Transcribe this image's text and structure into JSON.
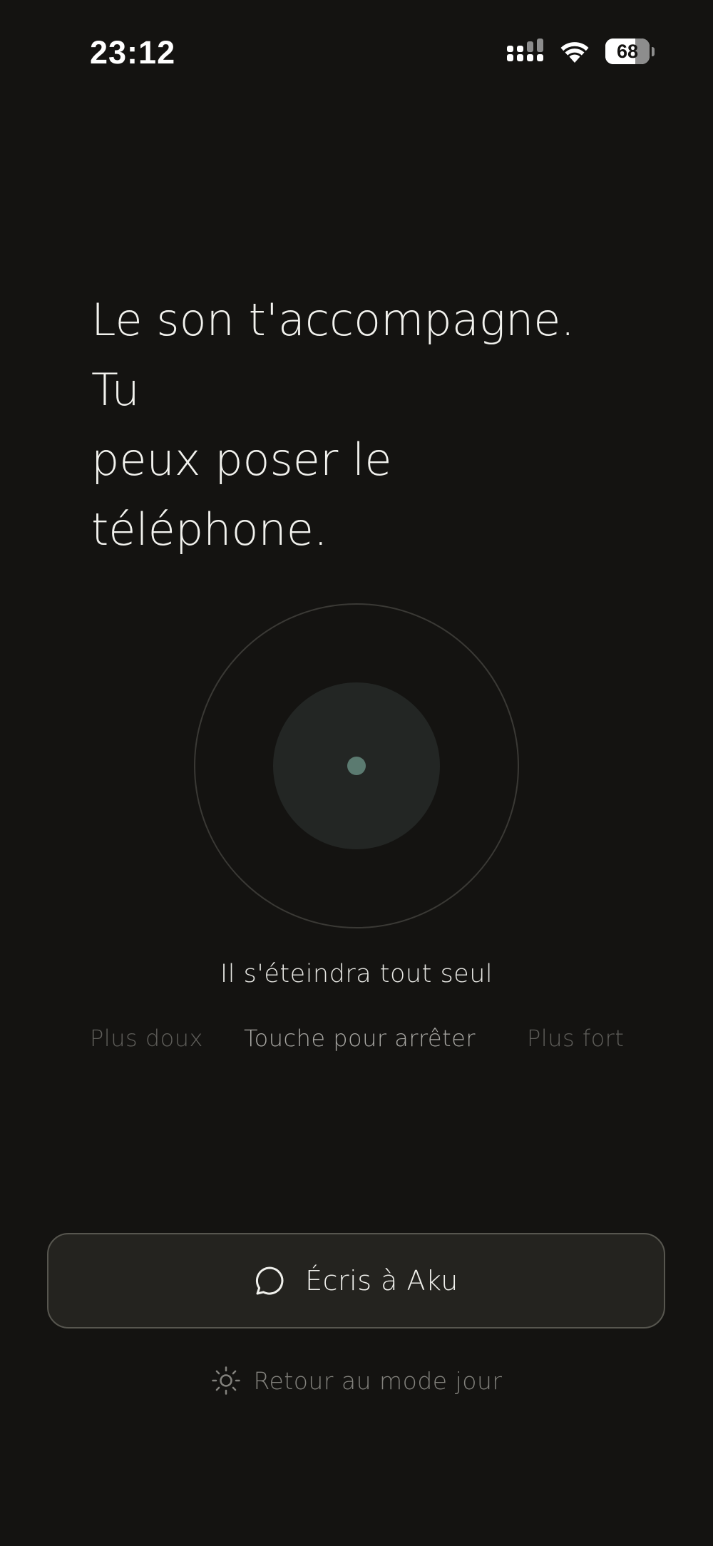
{
  "status_bar": {
    "time": "23:12",
    "battery_level": "68",
    "battery_fraction": 0.68,
    "icons": [
      "cellular-signal-icon",
      "wifi-icon",
      "battery-icon"
    ]
  },
  "headline": {
    "line1": "Le son t'accompagne. Tu",
    "line2": "peux poser le téléphone."
  },
  "player": {
    "auto_off_text": "Il s'éteindra tout seul",
    "softer_label": "Plus doux",
    "stop_label": "Touche pour arrêter",
    "louder_label": "Plus fort"
  },
  "actions": {
    "write_label": "Écris à Aku",
    "write_icon": "chat-bubble-icon",
    "day_mode_label": "Retour au mode jour",
    "day_mode_icon": "sun-icon"
  },
  "colors": {
    "background": "#141311",
    "accent_dot": "#5b7a70",
    "inner_circle": "#232624",
    "ring": "#3a3935"
  }
}
